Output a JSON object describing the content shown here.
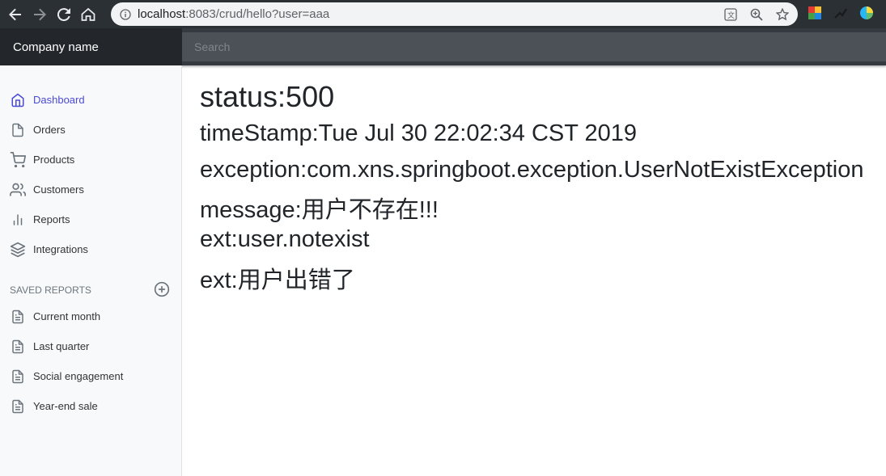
{
  "browser": {
    "url_host": "localhost",
    "url_rest": ":8083/crud/hello?user=aaa",
    "icons": [
      "back-icon",
      "forward-icon",
      "reload-icon",
      "home-icon",
      "info-icon",
      "translate-icon",
      "zoom-icon",
      "star-icon"
    ]
  },
  "navbar": {
    "brand": "Company name",
    "search_placeholder": "Search"
  },
  "sidebar": {
    "items": [
      {
        "label": "Dashboard",
        "icon": "home-icon",
        "active": true
      },
      {
        "label": "Orders",
        "icon": "file-icon"
      },
      {
        "label": "Products",
        "icon": "shopping-cart-icon"
      },
      {
        "label": "Customers",
        "icon": "users-icon"
      },
      {
        "label": "Reports",
        "icon": "bar-chart-icon"
      },
      {
        "label": "Integrations",
        "icon": "layers-icon"
      }
    ],
    "saved_reports_heading": "SAVED REPORTS",
    "saved_reports": [
      {
        "label": "Current month",
        "icon": "file-text-icon"
      },
      {
        "label": "Last quarter",
        "icon": "file-text-icon"
      },
      {
        "label": "Social engagement",
        "icon": "file-text-icon"
      },
      {
        "label": "Year-end sale",
        "icon": "file-text-icon"
      }
    ]
  },
  "error": {
    "status": "status:500",
    "timestamp": "timeStamp:Tue Jul 30 22:02:34 CST 2019",
    "exception": "exception:com.xns.springboot.exception.UserNotExistException",
    "message": "message:用户不存在!!!",
    "ext1": "ext:user.notexist",
    "ext2": "ext:用户出错了"
  },
  "colors": {
    "active": "#4a4ad6",
    "navbar": "#343a40",
    "brand_bg": "#23272b"
  }
}
